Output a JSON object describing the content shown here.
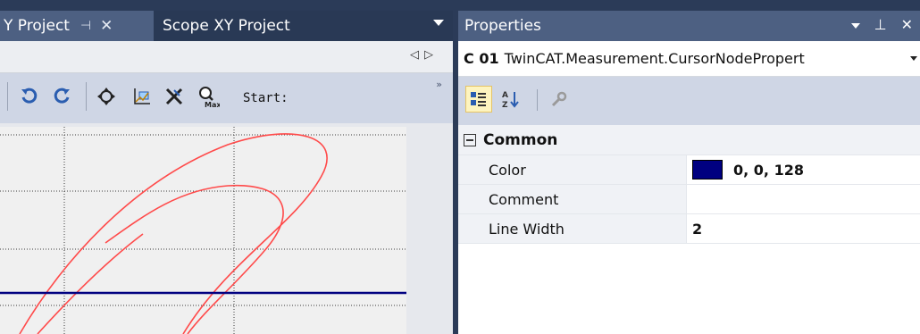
{
  "doc_tabs": {
    "inactive_label": "Y Project",
    "active_label": "Scope XY Project"
  },
  "toolbar": {
    "start_label": "Start:"
  },
  "properties": {
    "title": "Properties",
    "selector": {
      "name": "C 01",
      "type": "TwinCAT.Measurement.CursorNodePropert"
    },
    "category": "Common",
    "rows": [
      {
        "name": "Color",
        "value": "0, 0, 128",
        "swatch": "#000080"
      },
      {
        "name": "Comment",
        "value": ""
      },
      {
        "name": "Line Width",
        "value": "2"
      }
    ]
  },
  "icons": {
    "tab_pin": "pin-icon",
    "tab_close": "close-icon",
    "toolbar": [
      "undo-icon",
      "redo-icon",
      "pan-icon",
      "select-zoom-icon",
      "delete-icon",
      "zoom-max-icon"
    ],
    "props_toolbar": [
      "categorized-icon",
      "alphabetical-icon",
      "property-pages-icon"
    ]
  },
  "colors": {
    "accent": "#293955",
    "cursor_line": "#000080",
    "trace": "#ff4a4a"
  }
}
